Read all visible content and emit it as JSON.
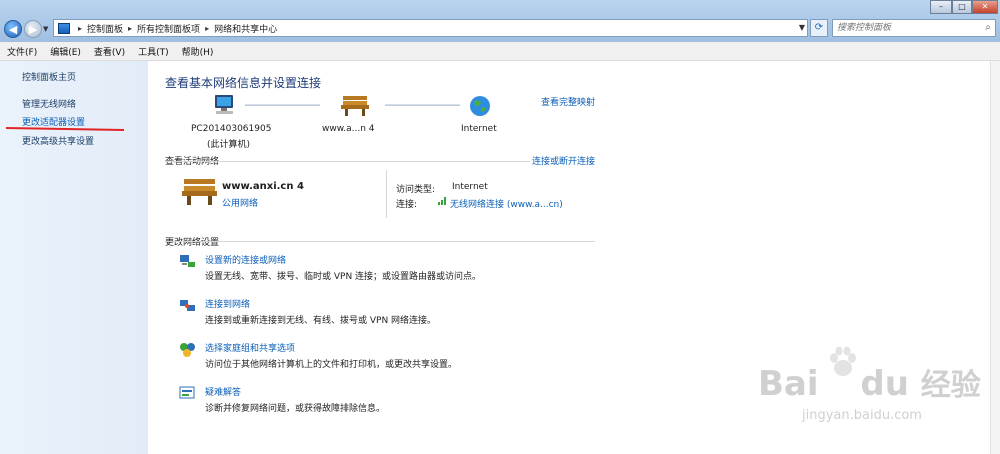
{
  "window": {
    "controls": [
      "–",
      "□",
      "✕"
    ]
  },
  "addressbar": {
    "crumbs": [
      "控制面板",
      "所有控制面板项",
      "网络和共享中心"
    ],
    "search_placeholder": "搜索控制面板"
  },
  "menu": [
    "文件(F)",
    "编辑(E)",
    "查看(V)",
    "工具(T)",
    "帮助(H)"
  ],
  "sidebar": {
    "items": [
      {
        "label": "控制面板主页"
      },
      {
        "label": "管理无线网络"
      },
      {
        "label": "更改适配器设置"
      },
      {
        "label": "更改高级共享设置"
      }
    ]
  },
  "main": {
    "title": "查看基本网络信息并设置连接",
    "full_map_link": "查看完整映射",
    "map": {
      "computer_name": "PC201403061905",
      "computer_sub": "(此计算机)",
      "network_name": "www.a...n 4",
      "internet": "Internet"
    },
    "active_section": "查看活动网络",
    "connect_disconnect": "连接或断开连接",
    "active_network": {
      "name": "www.anxi.cn 4",
      "type_link": "公用网络",
      "access_label": "访问类型:",
      "access_value": "Internet",
      "connection_label": "连接:",
      "connection_value": "无线网络连接 (www.a...cn)"
    },
    "change_section": "更改网络设置",
    "tasks": [
      {
        "title": "设置新的连接或网络",
        "desc": "设置无线、宽带、拨号、临时或 VPN 连接；或设置路由器或访问点。",
        "icon": "new-connection-icon"
      },
      {
        "title": "连接到网络",
        "desc": "连接到或重新连接到无线、有线、拨号或 VPN 网络连接。",
        "icon": "connect-network-icon"
      },
      {
        "title": "选择家庭组和共享选项",
        "desc": "访问位于其他网络计算机上的文件和打印机，或更改共享设置。",
        "icon": "homegroup-icon"
      },
      {
        "title": "疑难解答",
        "desc": "诊断并修复网络问题，或获得故障排除信息。",
        "icon": "troubleshoot-icon"
      }
    ]
  },
  "watermark": {
    "brand": "Bai",
    "brand_tail": "du",
    "brand_cn": "经验",
    "url": "jingyan.baidu.com"
  }
}
